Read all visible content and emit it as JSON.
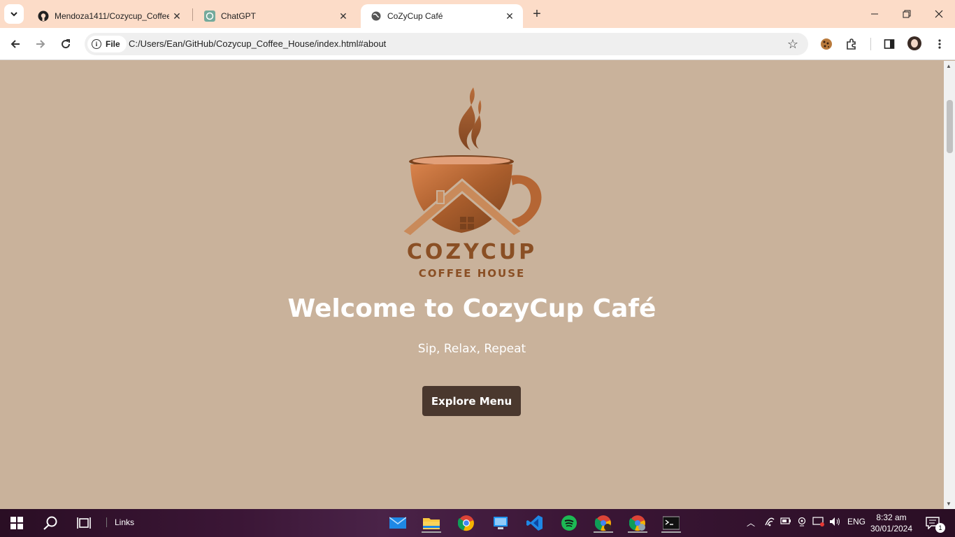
{
  "browser": {
    "tabs": [
      {
        "title": "Mendoza1411/Cozycup_Coffee",
        "icon": "github-icon",
        "active": false
      },
      {
        "title": "ChatGPT",
        "icon": "chatgpt-icon",
        "active": false
      },
      {
        "title": "CoZyCup Café",
        "icon": "globe-icon",
        "active": true
      }
    ],
    "omnibox": {
      "scheme_label": "File",
      "url": "C:/Users/Ean/GitHub/Cozycup_Coffee_House/index.html#about"
    }
  },
  "page": {
    "logo": {
      "brand": "COZYCUP",
      "sub": "COFFEE HOUSE"
    },
    "heading": "Welcome to CozyCup Café",
    "tagline": "Sip, Relax, Repeat",
    "cta_label": "Explore Menu"
  },
  "taskbar": {
    "toolbar_label": "Links",
    "language": "ENG",
    "time": "8:32 am",
    "date": "30/01/2024",
    "notification_count": "1"
  },
  "colors": {
    "page_bg": "#c9b29b",
    "tab_strip": "#fcdcc8",
    "button_bg": "#4a382e",
    "logo_brown": "#8a4f24",
    "logo_orange": "#c87645"
  }
}
